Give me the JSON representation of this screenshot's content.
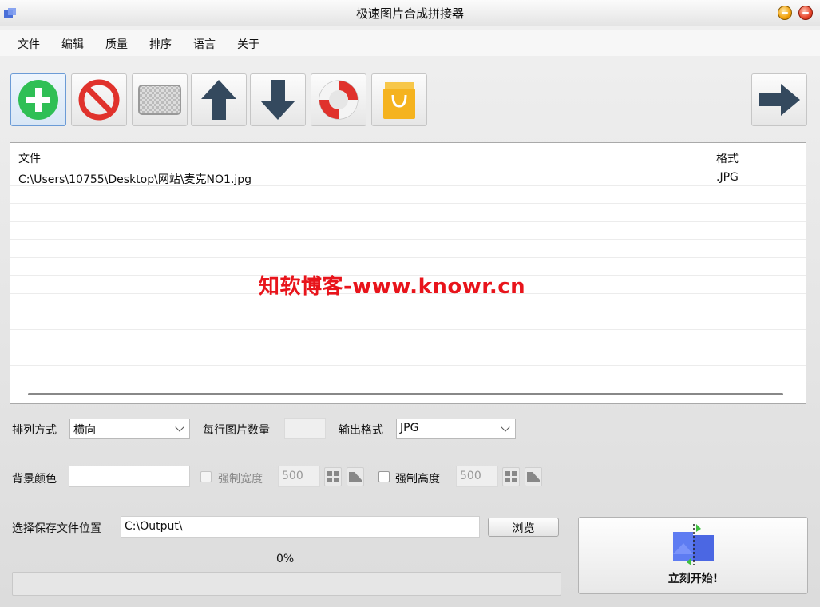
{
  "window": {
    "title": "极速图片合成拼接器"
  },
  "menu": [
    "文件",
    "编辑",
    "质量",
    "排序",
    "语言",
    "关于"
  ],
  "toolbar": {
    "icons": [
      "add-icon",
      "remove-icon",
      "clear-icon",
      "move-up-icon",
      "move-down-icon",
      "help-icon",
      "shop-icon",
      "next-icon"
    ],
    "colors": {
      "add": "#2fbf55",
      "remove": "#e0322c",
      "arrow": "#34495e",
      "shop": "#f5b31f"
    }
  },
  "file_list": {
    "columns": [
      "文件",
      "格式"
    ],
    "rows": [
      {
        "file": "C:\\Users\\10755\\Desktop\\网站\\麦克NO1.jpg",
        "format": ".JPG"
      }
    ]
  },
  "watermark": "知软博客-www.knowr.cn",
  "options": {
    "arrange_label": "排列方式",
    "arrange_value": "横向",
    "per_row_label": "每行图片数量",
    "per_row_value": "",
    "output_format_label": "输出格式",
    "output_format_value": "JPG",
    "bg_color_label": "背景颜色",
    "force_width_label": "强制宽度",
    "force_width_value": "500",
    "force_height_label": "强制高度",
    "force_height_value": "500",
    "save_label": "选择保存文件位置",
    "save_path": "C:\\Output\\",
    "browse_label": "浏览"
  },
  "progress": {
    "text": "0%",
    "value": 0
  },
  "start_button": {
    "label": "立刻开始!"
  }
}
